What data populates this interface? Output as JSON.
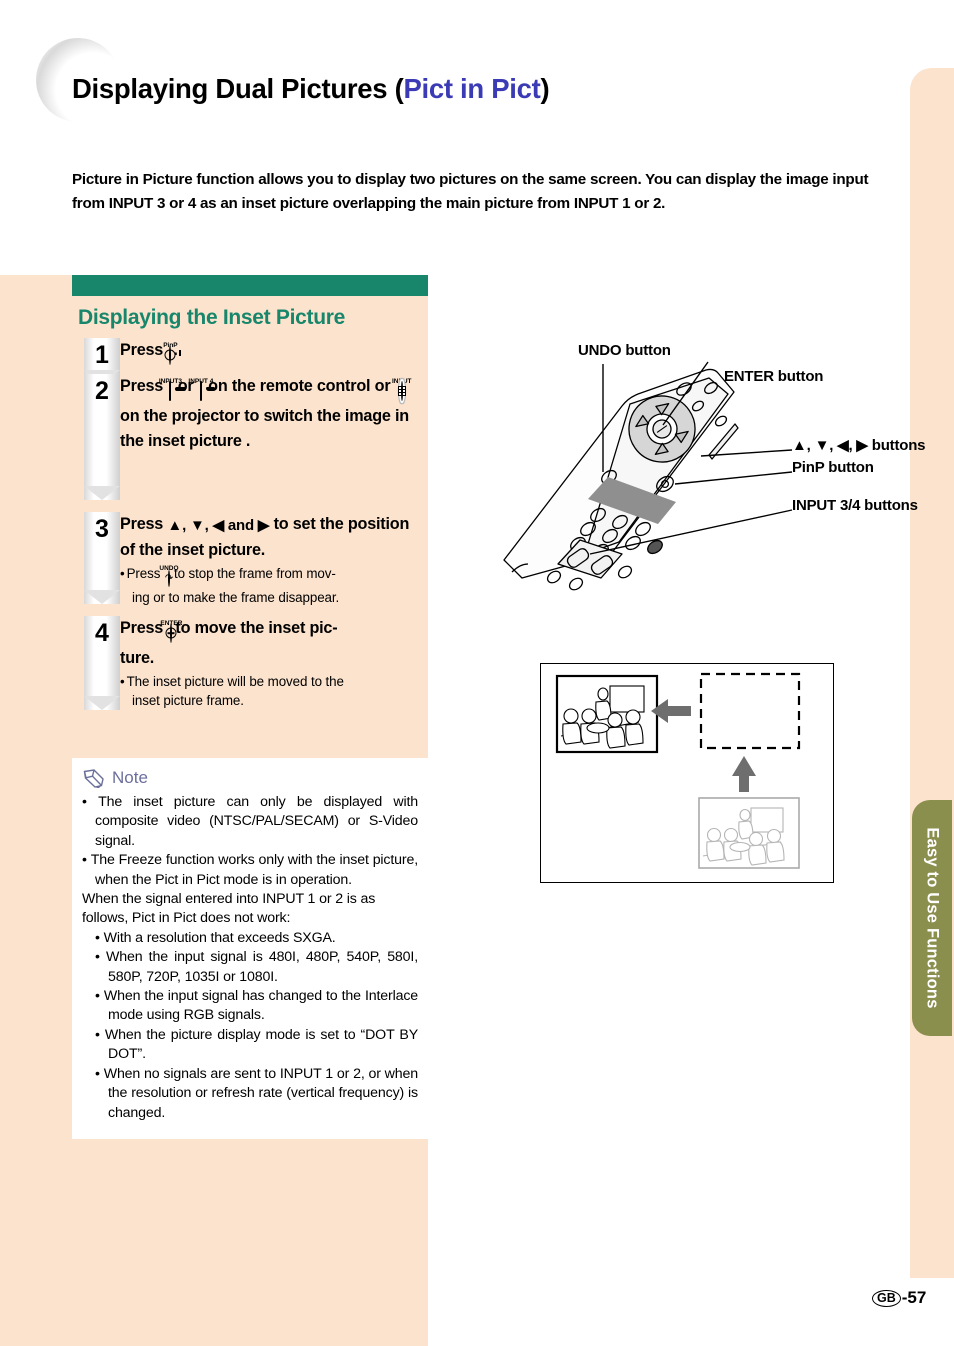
{
  "title": {
    "main": "Displaying Dual Pictures (",
    "accent": "Pict in Pict",
    "tail": ")"
  },
  "intro": "Picture in Picture function allows you to display two pictures on the same screen. You can display the image input from INPUT 3 or 4 as an inset picture overlapping the main picture from INPUT 1 or 2.",
  "section": {
    "heading": "Displaying the Inset Picture",
    "bar_color": "#17866b"
  },
  "steps": [
    {
      "num": "1",
      "prefix": "Press",
      "glyph_caption": "PinP",
      "suffix": "."
    },
    {
      "num": "2",
      "prefix": "Press",
      "glyph_caption_a": "INPUT3",
      "mid_or": "or",
      "glyph_caption_b": "INPUT 4",
      "mid_text": "on the remote control or",
      "glyph_caption_c": "INPUT",
      "suffix": "on the projector to switch the image in the inset picture ."
    },
    {
      "num": "3",
      "text_a": "Press",
      "arrows": "▲, ▼, ◀ and ▶",
      "text_b": "to set the position of the inset picture.",
      "bullet_prefix": "Press",
      "bullet_glyph_caption": "UNDO",
      "bullet_suffix": "to stop the frame from mov-",
      "bullet_line2": "ing or to make the frame disappear."
    },
    {
      "num": "4",
      "prefix": "Press",
      "glyph_caption": "ENTER",
      "suffix": "to move the inset pic-",
      "line2": "ture.",
      "bullet_line1": "The inset picture will be moved to the",
      "bullet_line2": "inset picture frame."
    }
  ],
  "note": {
    "label": "Note",
    "icon": "pencil-icon",
    "color": "#6b6f9c",
    "bullets": [
      "The inset picture can only be displayed with composite video (NTSC/PAL/SECAM) or S-Video signal.",
      "The Freeze function works only with the inset picture, when the Pict in Pict mode is in operation."
    ],
    "plain": "When the signal entered into INPUT 1 or 2 is as follows, Pict in Pict does not work:",
    "sub_bullets": [
      "With a resolution that exceeds SXGA.",
      "When the input signal is 480I, 480P, 540P, 580I, 580P, 720P, 1035I or 1080I.",
      "When the input signal has changed to the Interlace mode using RGB signals.",
      "When the picture display mode is set to “DOT BY DOT”.",
      "When no signals are sent to INPUT 1 or 2, or when the resolution or refresh rate (vertical frequency) is changed."
    ]
  },
  "remote_callouts": [
    {
      "label": "UNDO button"
    },
    {
      "label": "ENTER button"
    },
    {
      "label": "▲, ▼, ◀, ▶  buttons"
    },
    {
      "label": "PinP button"
    },
    {
      "label": "INPUT 3/4 buttons"
    }
  ],
  "side_tab": {
    "label": "Easy to Use Functions",
    "color": "#8b8f4e"
  },
  "footer": {
    "region": "GB",
    "page": "-57"
  }
}
